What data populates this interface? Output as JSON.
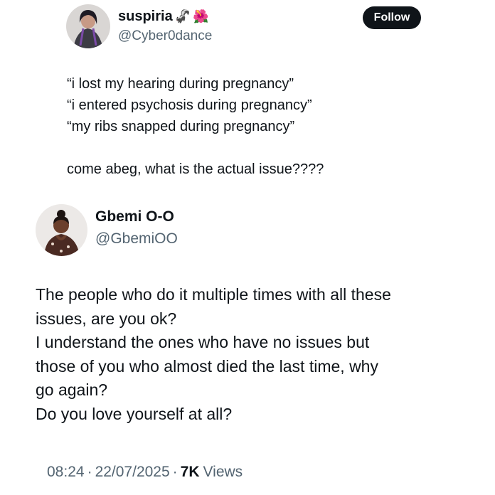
{
  "quoted_tweet": {
    "display_name": "suspiria",
    "name_emojis": [
      "🦨",
      "🌺"
    ],
    "handle": "@Cyber0dance",
    "follow_label": "Follow",
    "lines": [
      "“i lost my hearing during pregnancy”",
      "“i entered psychosis during pregnancy”",
      "“my ribs snapped during pregnancy”",
      "",
      "come abeg, what is the actual issue????"
    ]
  },
  "tweet": {
    "display_name": "Gbemi O-O",
    "handle": "@GbemiOO",
    "lines": [
      "The people who do it multiple times with all these",
      "issues, are you ok?",
      "I understand the ones who have no issues but",
      "those of you who almost died the last time, why",
      "go again?",
      "Do you love yourself at all?"
    ],
    "time": "08:24",
    "date": "22/07/2025",
    "views_count": "7K",
    "views_label": "Views",
    "separator": "·"
  },
  "colors": {
    "text": "#0f1419",
    "secondary": "#536471",
    "follow_bg": "#0f1419",
    "follow_text": "#ffffff"
  }
}
